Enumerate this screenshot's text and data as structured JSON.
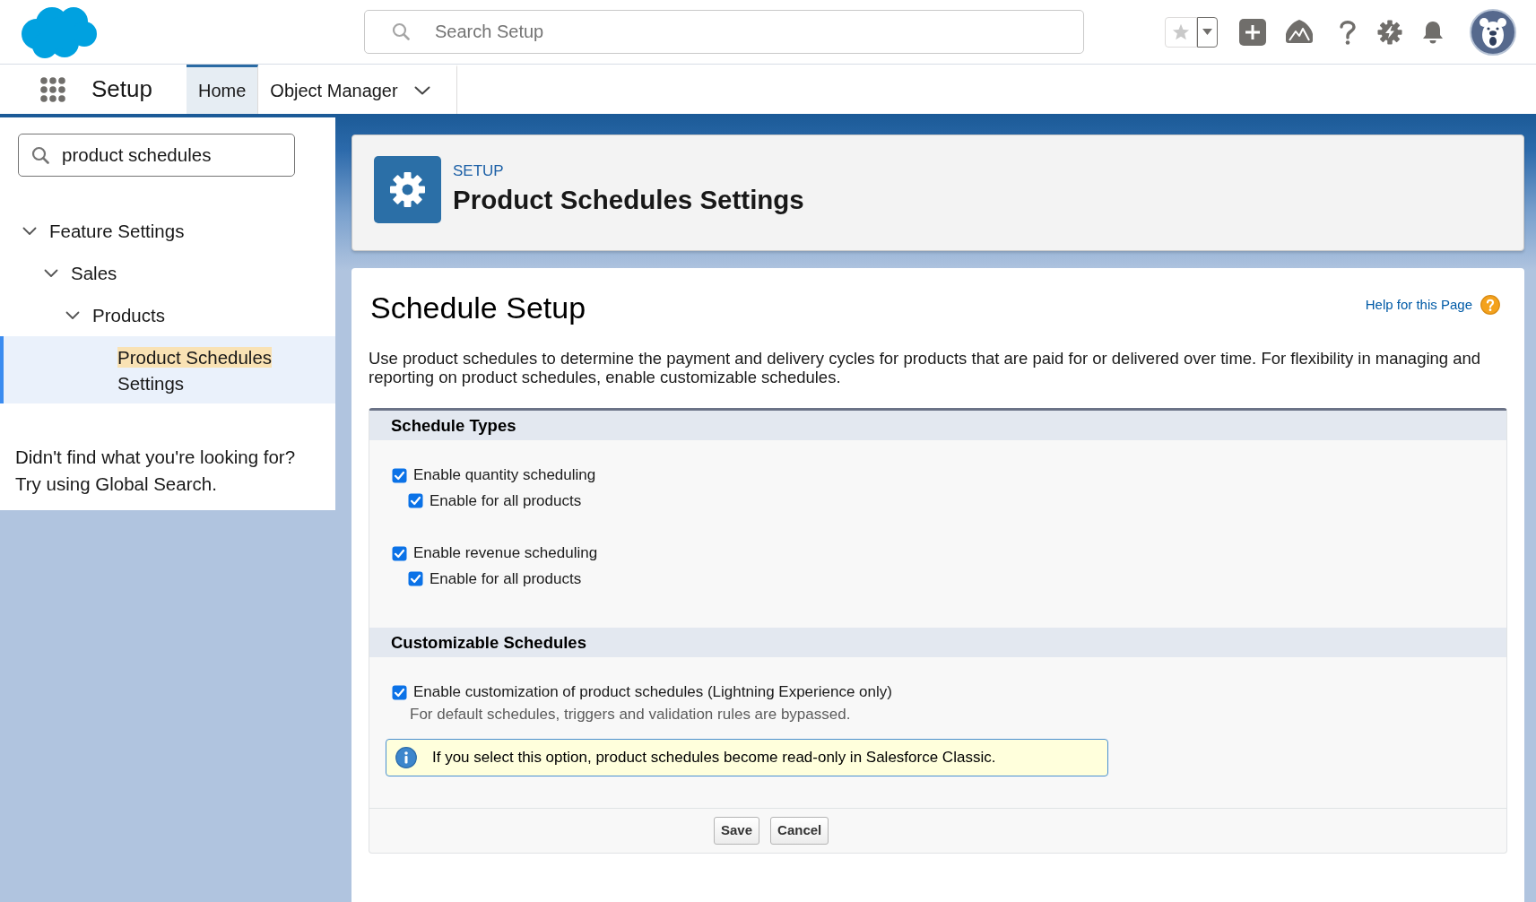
{
  "header": {
    "search": {
      "placeholder": "Search Setup"
    }
  },
  "nav": {
    "app_name": "Setup",
    "tabs": [
      {
        "label": "Home",
        "selected": true,
        "has_menu": false
      },
      {
        "label": "Object Manager",
        "selected": false,
        "has_menu": true
      }
    ]
  },
  "sidebar": {
    "search": {
      "value": "product schedules"
    },
    "tree": [
      {
        "label": "Feature Settings",
        "expanded": true,
        "selected": false,
        "children": [
          {
            "label": "Sales",
            "expanded": true,
            "selected": false,
            "children": [
              {
                "label": "Products",
                "expanded": true,
                "selected": false,
                "children": [
                  {
                    "label_parts": [
                      {
                        "text": "Product Schedules",
                        "highlighted": true
                      },
                      {
                        "text": "Settings",
                        "highlighted": false
                      }
                    ],
                    "selected": true
                  }
                ]
              }
            ]
          }
        ]
      }
    ],
    "not_found": [
      "Didn't find what you're looking for?",
      "Try using Global Search."
    ]
  },
  "page_header": {
    "eyebrow": "SETUP",
    "title": "Product Schedules Settings"
  },
  "content": {
    "title": "Schedule Setup",
    "help_link": "Help for this Page",
    "description": "Use product schedules to determine the payment and delivery cycles for products that are paid for or delivered over time. For flexibility in managing and reporting on product schedules, enable customizable schedules.",
    "sections": [
      {
        "title": "Schedule Types",
        "items": [
          {
            "label": "Enable quantity scheduling",
            "checked": true,
            "children": [
              {
                "label": "Enable for all products",
                "checked": true
              }
            ]
          },
          {
            "label": "Enable revenue scheduling",
            "checked": true,
            "children": [
              {
                "label": "Enable for all products",
                "checked": true
              }
            ]
          }
        ]
      },
      {
        "title": "Customizable Schedules",
        "items": [
          {
            "label": "Enable customization of product schedules (Lightning Experience only)",
            "checked": true,
            "hint": "For default schedules, triggers and validation rules are bypassed."
          }
        ],
        "info": "If you select this option, product schedules become read-only in Salesforce Classic."
      }
    ],
    "buttons": [
      "Save",
      "Cancel"
    ]
  }
}
